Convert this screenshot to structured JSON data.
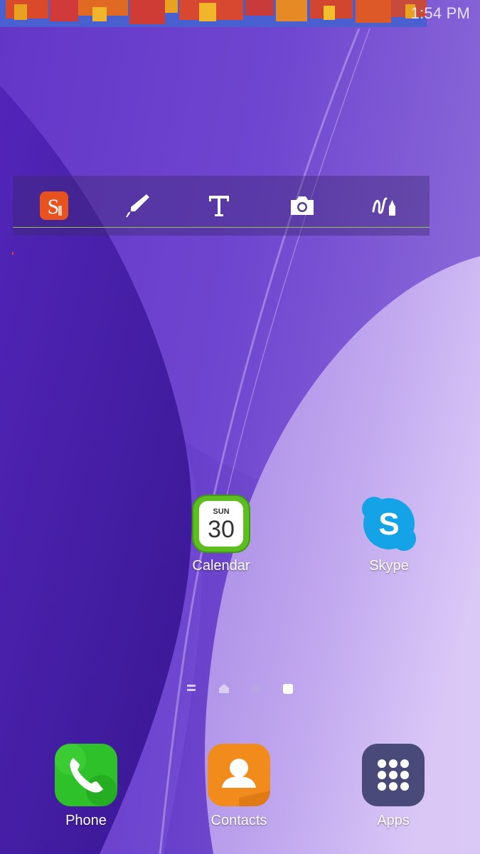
{
  "status_bar": {
    "time": "1:54 PM"
  },
  "toolbar_widget": {
    "tools": [
      {
        "icon": "scrapbook-s-icon"
      },
      {
        "icon": "pen-icon"
      },
      {
        "icon": "text-t-icon"
      },
      {
        "icon": "camera-icon"
      },
      {
        "icon": "brush-marker-icon"
      }
    ]
  },
  "home_apps": [
    {
      "label": "Calendar",
      "icon": "calendar-icon",
      "calendar_day": "SUN",
      "calendar_date": "30"
    },
    {
      "label": "Skype",
      "icon": "skype-icon",
      "glyph": "S"
    }
  ],
  "page_indicator": {
    "pages": [
      "menu",
      "home",
      "page",
      "page"
    ],
    "current_page": 4
  },
  "dock": [
    {
      "label": "Phone",
      "icon": "phone-icon"
    },
    {
      "label": "Contacts",
      "icon": "contacts-icon"
    },
    {
      "label": "Apps",
      "icon": "apps-grid-icon"
    }
  ],
  "colors": {
    "wallpaper_dark": "#3a1890",
    "wallpaper_mid": "#6a3fd0",
    "wallpaper_light": "#d9c4f6",
    "toolbar_accent_line": "#9ccf4c",
    "calendar_green": "#5cbf1f",
    "skype_blue": "#14a3e6",
    "phone_green": "#2fc12a",
    "contacts_orange": "#f08b1c",
    "apps_slate": "#4a4a7a"
  }
}
